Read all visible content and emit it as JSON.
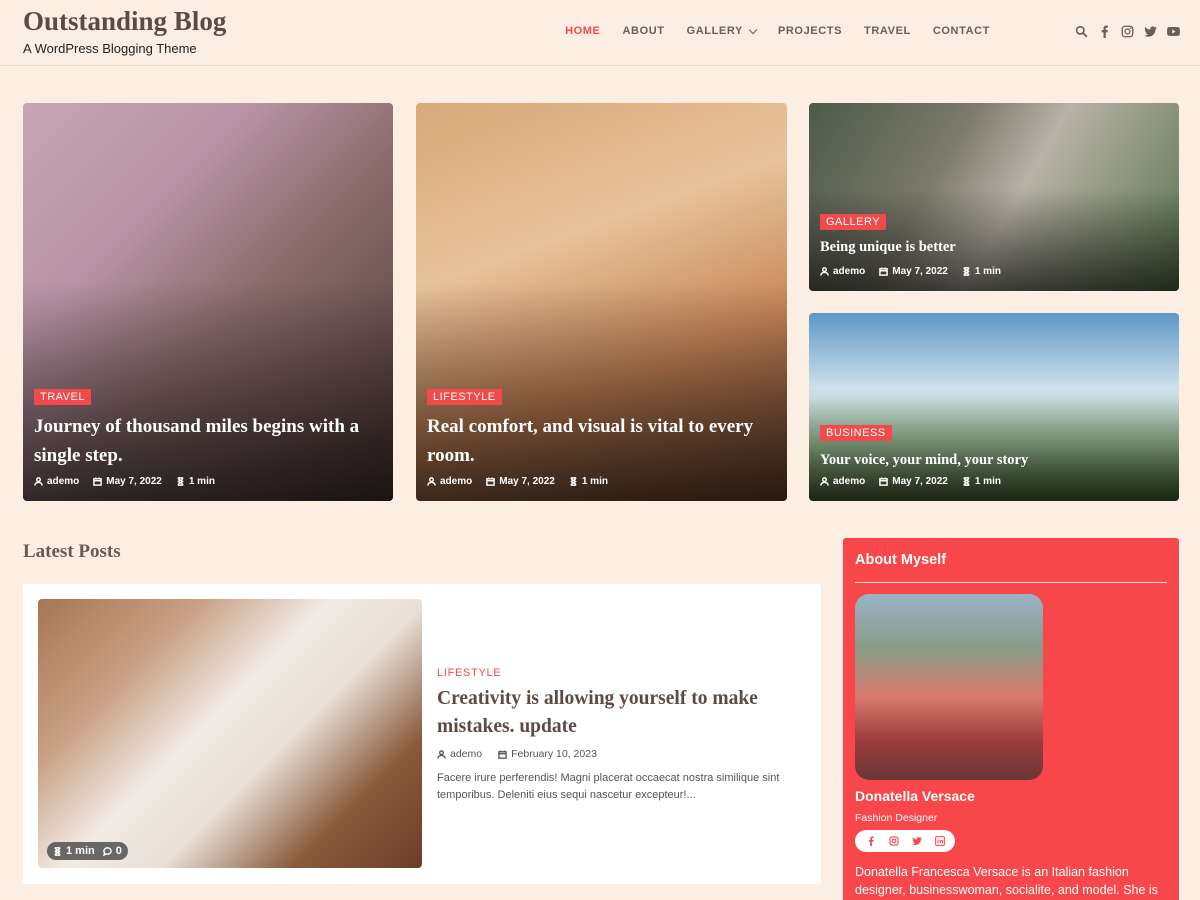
{
  "site": {
    "title": "Outstanding Blog",
    "tagline": "A WordPress Blogging Theme"
  },
  "nav": {
    "items": [
      {
        "label": "HOME",
        "active": true
      },
      {
        "label": "ABOUT"
      },
      {
        "label": "GALLERY",
        "has_dropdown": true
      },
      {
        "label": "PROJECTS"
      },
      {
        "label": "TRAVEL"
      },
      {
        "label": "CONTACT"
      }
    ],
    "icons": [
      "search-icon",
      "facebook-icon",
      "instagram-icon",
      "twitter-icon",
      "youtube-icon"
    ]
  },
  "featured": [
    {
      "category": "TRAVEL",
      "title": "Journey of thousand miles begins with a single step.",
      "author": "ademo",
      "date": "May 7, 2022",
      "read_time": "1 min"
    },
    {
      "category": "LIFESTYLE",
      "title": "Real comfort, and visual is vital to every room.",
      "author": "ademo",
      "date": "May 7, 2022",
      "read_time": "1 min"
    },
    {
      "category": "GALLERY",
      "title": "Being unique is better",
      "author": "ademo",
      "date": "May 7, 2022",
      "read_time": "1 min"
    },
    {
      "category": "BUSINESS",
      "title": "Your voice, your mind, your story",
      "author": "ademo",
      "date": "May 7, 2022",
      "read_time": "1 min"
    }
  ],
  "latest": {
    "heading": "Latest Posts",
    "post": {
      "category": "LIFESTYLE",
      "title": "Creativity is allowing yourself to make mistakes. update",
      "author": "ademo",
      "date": "February 10, 2023",
      "excerpt": "Facere irure perferendis! Magni placerat occaecat nostra similique sint temporibus. Deleniti eius sequi nascetur excepteur!...",
      "read_time": "1 min",
      "comments": "0"
    }
  },
  "sidebar": {
    "title": "About Myself",
    "name": "Donatella Versace",
    "role": "Fashion Designer",
    "social_icons": [
      "facebook-icon",
      "instagram-icon",
      "twitter-icon",
      "linkedin-icon"
    ],
    "bio": "Donatella Francesca Versace is an Italian fashion designer, businesswoman, socialite, and model. She is the"
  },
  "colors": {
    "accent": "#f24a4a",
    "background": "#fdeee3",
    "sidebar": "#f7474b",
    "title": "#5c4b44"
  }
}
